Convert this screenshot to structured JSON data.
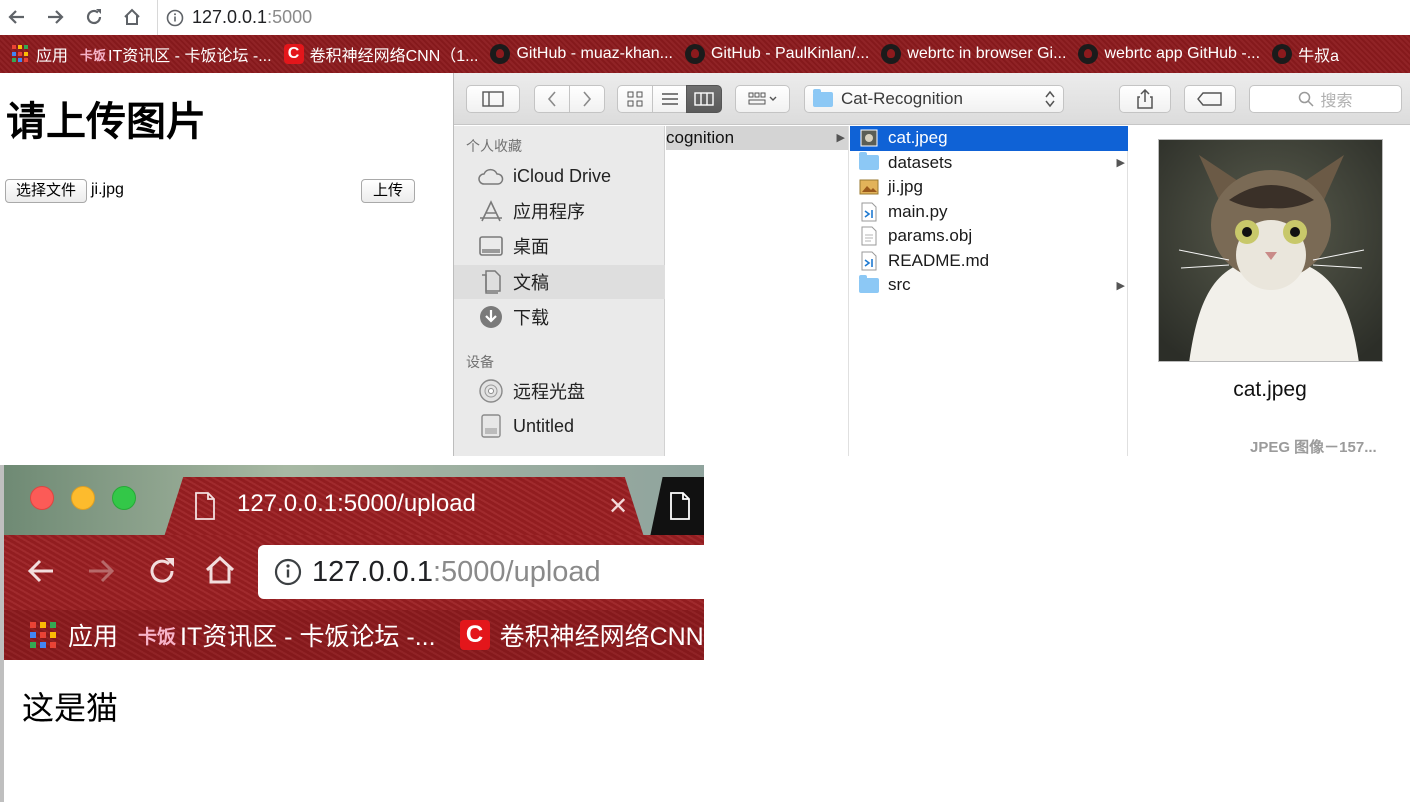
{
  "top_browser": {
    "url_host": "127.0.0.1",
    "url_port": ":5000",
    "bookmarks": [
      {
        "label": "应用",
        "icon": "apps-grid-icon"
      },
      {
        "label": "IT资讯区 - 卡饭论坛 -...",
        "icon": "kafan-icon"
      },
      {
        "label": "卷积神经网络CNN（1...",
        "icon": "c-logo-icon"
      },
      {
        "label": "GitHub - muaz-khan...",
        "icon": "github-icon"
      },
      {
        "label": "GitHub - PaulKinlan/...",
        "icon": "github-icon"
      },
      {
        "label": "webrtc in browser Gi...",
        "icon": "github-icon"
      },
      {
        "label": "webrtc app GitHub -...",
        "icon": "github-icon"
      },
      {
        "label": "牛叔a",
        "icon": "github-icon"
      }
    ],
    "kafan_icon_text": "卡饭"
  },
  "upload_page": {
    "title": "请上传图片",
    "choose_file_label": "选择文件",
    "file_name": "ji.jpg",
    "upload_label": "上传"
  },
  "finder": {
    "path_popup": "Cat-Recognition",
    "search_placeholder": "搜索",
    "sidebar": {
      "favorites_heading": "个人收藏",
      "favorites": [
        {
          "label": "iCloud Drive",
          "icon": "cloud-icon"
        },
        {
          "label": "应用程序",
          "icon": "applications-icon"
        },
        {
          "label": "桌面",
          "icon": "desktop-icon"
        },
        {
          "label": "文稿",
          "icon": "documents-icon"
        },
        {
          "label": "下载",
          "icon": "download-icon"
        }
      ],
      "devices_heading": "设备",
      "devices": [
        {
          "label": "远程光盘",
          "icon": "disc-icon"
        },
        {
          "label": "Untitled",
          "icon": "drive-icon"
        }
      ]
    },
    "column1_item": "cognition",
    "files": [
      {
        "name": "cat.jpeg",
        "icon": "image-thumb-icon",
        "selected": true,
        "has_children": false
      },
      {
        "name": "datasets",
        "icon": "folder-icon",
        "selected": false,
        "has_children": true
      },
      {
        "name": "ji.jpg",
        "icon": "image-thumb-icon",
        "selected": false,
        "has_children": false
      },
      {
        "name": "main.py",
        "icon": "vscode-file-icon",
        "selected": false,
        "has_children": false
      },
      {
        "name": "params.obj",
        "icon": "document-icon",
        "selected": false,
        "has_children": false
      },
      {
        "name": "README.md",
        "icon": "vscode-file-icon",
        "selected": false,
        "has_children": false
      },
      {
        "name": "src",
        "icon": "folder-icon",
        "selected": false,
        "has_children": true
      }
    ],
    "preview_name": "cat.jpeg",
    "preview_meta": "JPEG 图像－157..."
  },
  "bottom_browser": {
    "tab_title": "127.0.0.1:5000/upload",
    "url_host": "127.0.0.1",
    "url_path": ":5000/upload",
    "bookmarks": [
      {
        "label": "应用"
      },
      {
        "label": "IT资讯区 - 卡饭论坛 -..."
      },
      {
        "label": "卷积神经网络CNN"
      }
    ],
    "result_text": "这是猫"
  },
  "colors": {
    "theme_red": "#8c1a1d",
    "finder_selection": "#0f62d6",
    "folder_blue": "#8cc8f5",
    "close_red": "#fc5b57",
    "minimize_yellow": "#fdbb2d",
    "zoom_green": "#33c748"
  }
}
